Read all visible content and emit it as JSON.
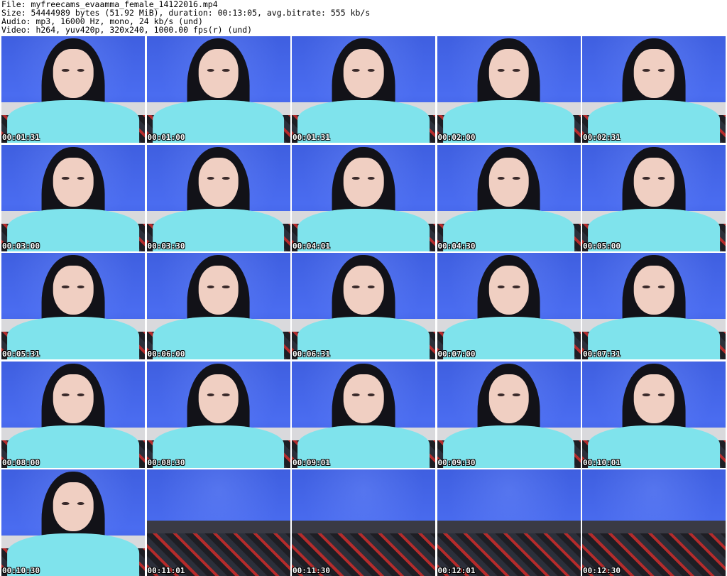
{
  "header": {
    "file": "File: myfreecams_evaamma_female_14122016.mp4",
    "size": "Size: 54444989 bytes (51.92 MiB), duration: 00:13:05, avg.bitrate: 555 kb/s",
    "audio": "Audio: mp3, 16000 Hz, mono, 24 kb/s (und)",
    "video": "Video: h264, yuv420p, 320x240, 1000.00 fps(r) (und)"
  },
  "thumbnails": [
    {
      "time": "00:01:31",
      "empty": false
    },
    {
      "time": "00:01:00",
      "empty": false
    },
    {
      "time": "00:01:31",
      "empty": false
    },
    {
      "time": "00:02:00",
      "empty": false
    },
    {
      "time": "00:02:31",
      "empty": false
    },
    {
      "time": "00:03:00",
      "empty": false
    },
    {
      "time": "00:03:30",
      "empty": false
    },
    {
      "time": "00:04:01",
      "empty": false
    },
    {
      "time": "00:04:30",
      "empty": false
    },
    {
      "time": "00:05:00",
      "empty": false
    },
    {
      "time": "00:05:31",
      "empty": false
    },
    {
      "time": "00:06:00",
      "empty": false
    },
    {
      "time": "00:06:31",
      "empty": false
    },
    {
      "time": "00:07:00",
      "empty": false
    },
    {
      "time": "00:07:31",
      "empty": false
    },
    {
      "time": "00:08:00",
      "empty": false
    },
    {
      "time": "00:08:30",
      "empty": false
    },
    {
      "time": "00:09:01",
      "empty": false
    },
    {
      "time": "00:09:30",
      "empty": false
    },
    {
      "time": "00:10:01",
      "empty": false
    },
    {
      "time": "00:10:30",
      "empty": false
    },
    {
      "time": "00:11:01",
      "empty": true
    },
    {
      "time": "00:11:30",
      "empty": true
    },
    {
      "time": "00:12:01",
      "empty": true
    },
    {
      "time": "00:12:30",
      "empty": true
    }
  ]
}
